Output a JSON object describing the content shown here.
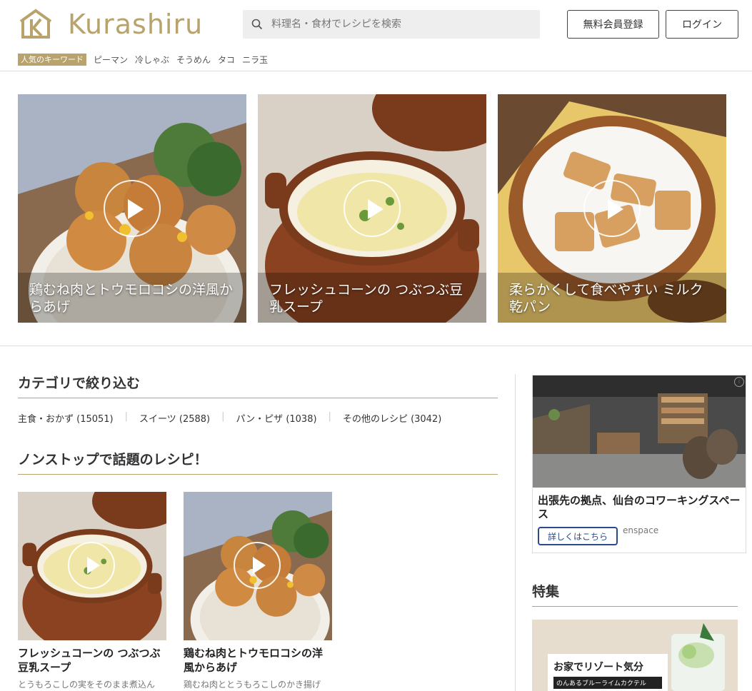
{
  "header": {
    "logo_text": "Kurashiru",
    "search_placeholder": "料理名・食材でレシピを検索",
    "register_label": "無料会員登録",
    "login_label": "ログイン",
    "keywords_label": "人気のキーワード",
    "keywords": [
      "ピーマン",
      "冷しゃぶ",
      "そうめん",
      "タコ",
      "ニラ玉"
    ]
  },
  "hero": [
    {
      "title": "鶏むね肉とトウモロコシの洋風からあげ"
    },
    {
      "title": "フレッシュコーンの つぶつぶ豆乳スープ"
    },
    {
      "title": "柔らかくして食べやすい ミルク乾パン"
    }
  ],
  "categories": {
    "title": "カテゴリで絞り込む",
    "items": [
      {
        "label": "主食・おかず (15051)"
      },
      {
        "label": "スイーツ (2588)"
      },
      {
        "label": "パン・ピザ (1038)"
      },
      {
        "label": "その他のレシピ (3042)"
      }
    ]
  },
  "nonstop": {
    "title": "ノンストップで話題のレシピ！",
    "cards": [
      {
        "title": "フレッシュコーンの つぶつぶ豆乳スープ",
        "desc": "とうもろこしの実をそのまま煮込ん"
      },
      {
        "title": "鶏むね肉とトウモロコシの洋風からあげ",
        "desc": "鶏むね肉ととうもろこしのかき揚げ"
      }
    ]
  },
  "ad": {
    "info": "i",
    "title": "出張先の拠点、仙台のコワーキングスペース",
    "button": "詳しくはこちら",
    "brand": "enspace"
  },
  "feature": {
    "title": "特集",
    "line1": "お家でリゾート気分",
    "line2": "のんあるブルーライムカクテル"
  },
  "colors": {
    "accent": "#b9a36c",
    "ad_button": "#2a4a8c"
  }
}
